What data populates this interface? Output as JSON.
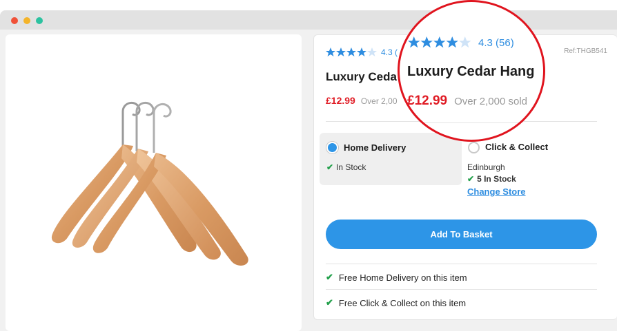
{
  "window": {
    "controls": [
      "close",
      "minimize",
      "maximize"
    ]
  },
  "product": {
    "image_alt_icon": "wooden-hangers-image",
    "rating_value": "4.3",
    "rating_count": "(56)",
    "rating_display_short": "4.3 (",
    "ref": "Ref:THGB541",
    "title_visible": "Luxury Ceda",
    "title_magnified": "Luxury Cedar Hang",
    "price": "£12.99",
    "sold_visible": "Over 2,00",
    "sold_magnified": "Over 2,000 sold"
  },
  "delivery": {
    "home_label": "Home Delivery",
    "home_stock": "In Stock",
    "collect_label": "Click & Collect",
    "collect_store": "Edinburgh",
    "collect_stock": "5 In Stock",
    "change_store": "Change Store"
  },
  "actions": {
    "add_to_basket": "Add To Basket"
  },
  "features": [
    "Free Home Delivery on this item",
    "Free Click & Collect on this item"
  ],
  "colors": {
    "accent_blue": "#2d95e7",
    "price_red": "#e01b24",
    "check_green": "#23a04b",
    "magnifier_border": "#e0141e"
  }
}
